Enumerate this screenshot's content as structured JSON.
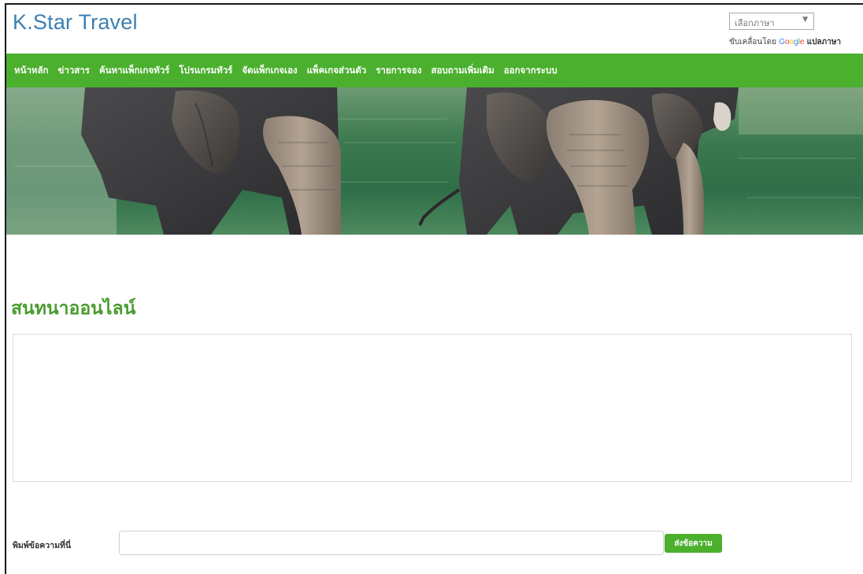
{
  "header": {
    "brand": "K.Star Travel",
    "language_select": {
      "selected": "เลือกภาษา"
    },
    "powered_by": {
      "prefix": "ขับเคลื่อนโดย",
      "google_letters": [
        "G",
        "o",
        "o",
        "g",
        "l",
        "e"
      ],
      "translate_label": "แปลภาษา"
    }
  },
  "nav": {
    "items": [
      {
        "label": "หน้าหลัก"
      },
      {
        "label": "ข่าวสาร"
      },
      {
        "label": "ค้นหาแพ็กเกจทัวร์"
      },
      {
        "label": "โปรแกรมทัวร์"
      },
      {
        "label": "จัดแพ็กเกจเอง"
      },
      {
        "label": "แพ็คเกจส่วนตัว"
      },
      {
        "label": "รายการจอง"
      },
      {
        "label": "สอบถามเพิ่มเติม"
      },
      {
        "label": "ออกจากระบบ"
      }
    ]
  },
  "colors": {
    "brand": "#3d7fb0",
    "nav_bg": "#4bb02e",
    "title": "#4a9c2f"
  },
  "chat": {
    "title": "สนทนาออนไลน์",
    "input_label": "พิมพ์ข้อความที่นี่",
    "input_value": "",
    "send_label": "ส่งข้อความ"
  }
}
